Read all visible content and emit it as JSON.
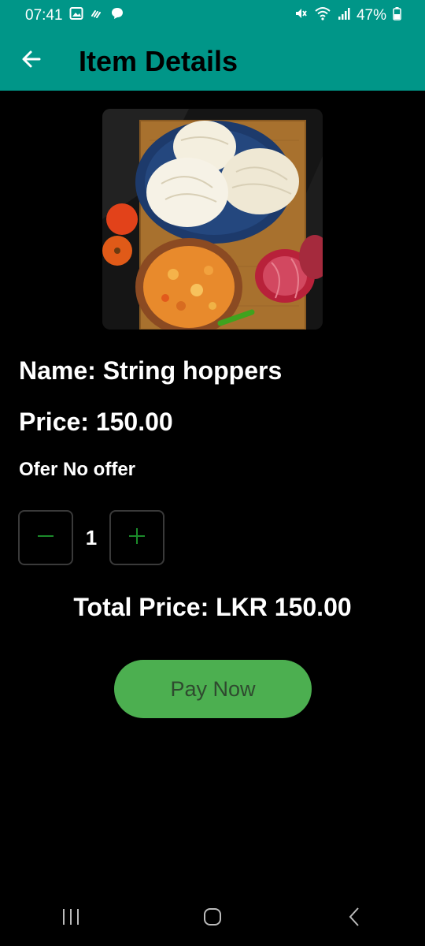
{
  "status_bar": {
    "time": "07:41",
    "battery": "47%",
    "icons_left": [
      "gallery-icon",
      "wifi-calling-icon",
      "message-icon"
    ],
    "icons_right": [
      "mute-icon",
      "wifi-icon",
      "signal-icon",
      "battery-icon"
    ]
  },
  "app_bar": {
    "title": "Item Details",
    "back_icon": "arrow-left-icon"
  },
  "item": {
    "name_line": "Name: String hoppers",
    "price_line": "Price: 150.00",
    "offer_line": "Ofer No offer"
  },
  "quantity": {
    "value": "1",
    "decrement_icon": "minus-icon",
    "increment_icon": "plus-icon"
  },
  "total_line": "Total Price: LKR 150.00",
  "pay_button_label": "Pay Now",
  "colors": {
    "app_bar": "#009688",
    "background": "#000000",
    "pay_button": "#4caf50",
    "stepper_icon": "#1b8a2a"
  },
  "nav_bar": {
    "icons": [
      "recents-icon",
      "home-icon",
      "back-nav-icon"
    ]
  }
}
